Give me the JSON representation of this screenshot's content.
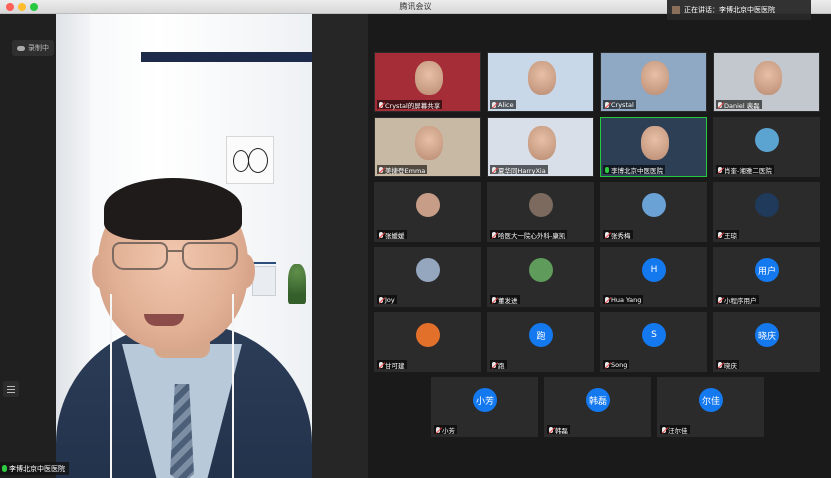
{
  "window": {
    "title": "腾讯会议"
  },
  "recording": {
    "label": "录制中"
  },
  "speaking": {
    "label": "正在讲话：李博北京中医医院"
  },
  "main_video": {
    "name": "李博北京中医医院"
  },
  "participants": [
    {
      "name": "Crystal的屏幕共享",
      "kind": "video",
      "bg": "#a42d38"
    },
    {
      "name": "Alice",
      "kind": "video",
      "bg": "#c9d8e8"
    },
    {
      "name": "Crystal",
      "kind": "video",
      "bg": "#8fa8c4"
    },
    {
      "name": "Daniel 裴磊",
      "kind": "video",
      "bg": "#c2c8cd"
    },
    {
      "name": "美捷登Emma",
      "kind": "video",
      "bg": "#c8b9a4"
    },
    {
      "name": "夏华同HarryXia",
      "kind": "video",
      "bg": "#d8dfe8"
    },
    {
      "name": "李博北京中医医院",
      "kind": "video",
      "bg": "#2d3f55",
      "active": true
    },
    {
      "name": "肖奎-湘雅二医院",
      "kind": "avatar-img",
      "bg": "#5ba3d0"
    },
    {
      "name": "张媛媛",
      "kind": "avatar-img",
      "bg": "#c79d88"
    },
    {
      "name": "哈医大一院心外科-康凯",
      "kind": "avatar-img",
      "bg": "#7c6a5e"
    },
    {
      "name": "张秀梅",
      "kind": "avatar-img",
      "bg": "#6aa2d6"
    },
    {
      "name": "王琼",
      "kind": "avatar-img",
      "bg": "#1f3a5a"
    },
    {
      "name": "Joy",
      "kind": "avatar-img",
      "bg": "#95a7bf"
    },
    {
      "name": "董发进",
      "kind": "avatar-img",
      "bg": "#5f9b5a"
    },
    {
      "name": "Hua Yang",
      "kind": "avatar-text",
      "initial": "H"
    },
    {
      "name": "小程序用户",
      "kind": "avatar-text",
      "initial": "用户"
    },
    {
      "name": "甘可建",
      "kind": "avatar-img",
      "bg": "#e2702b"
    },
    {
      "name": "跑",
      "kind": "avatar-text",
      "initial": "跑"
    },
    {
      "name": "Song",
      "kind": "avatar-text",
      "initial": "S"
    },
    {
      "name": "晓庆",
      "kind": "avatar-text",
      "initial": "晓庆"
    },
    {
      "name": "小芳",
      "kind": "avatar-text",
      "initial": "小芳"
    },
    {
      "name": "韩磊",
      "kind": "avatar-text",
      "initial": "韩磊"
    },
    {
      "name": "汪尔佳",
      "kind": "avatar-text",
      "initial": "尔佳"
    }
  ],
  "icons": {
    "mic": "microphone-icon",
    "mic_muted": "microphone-muted-icon",
    "menu": "list-menu-icon",
    "cloud": "cloud-icon"
  }
}
